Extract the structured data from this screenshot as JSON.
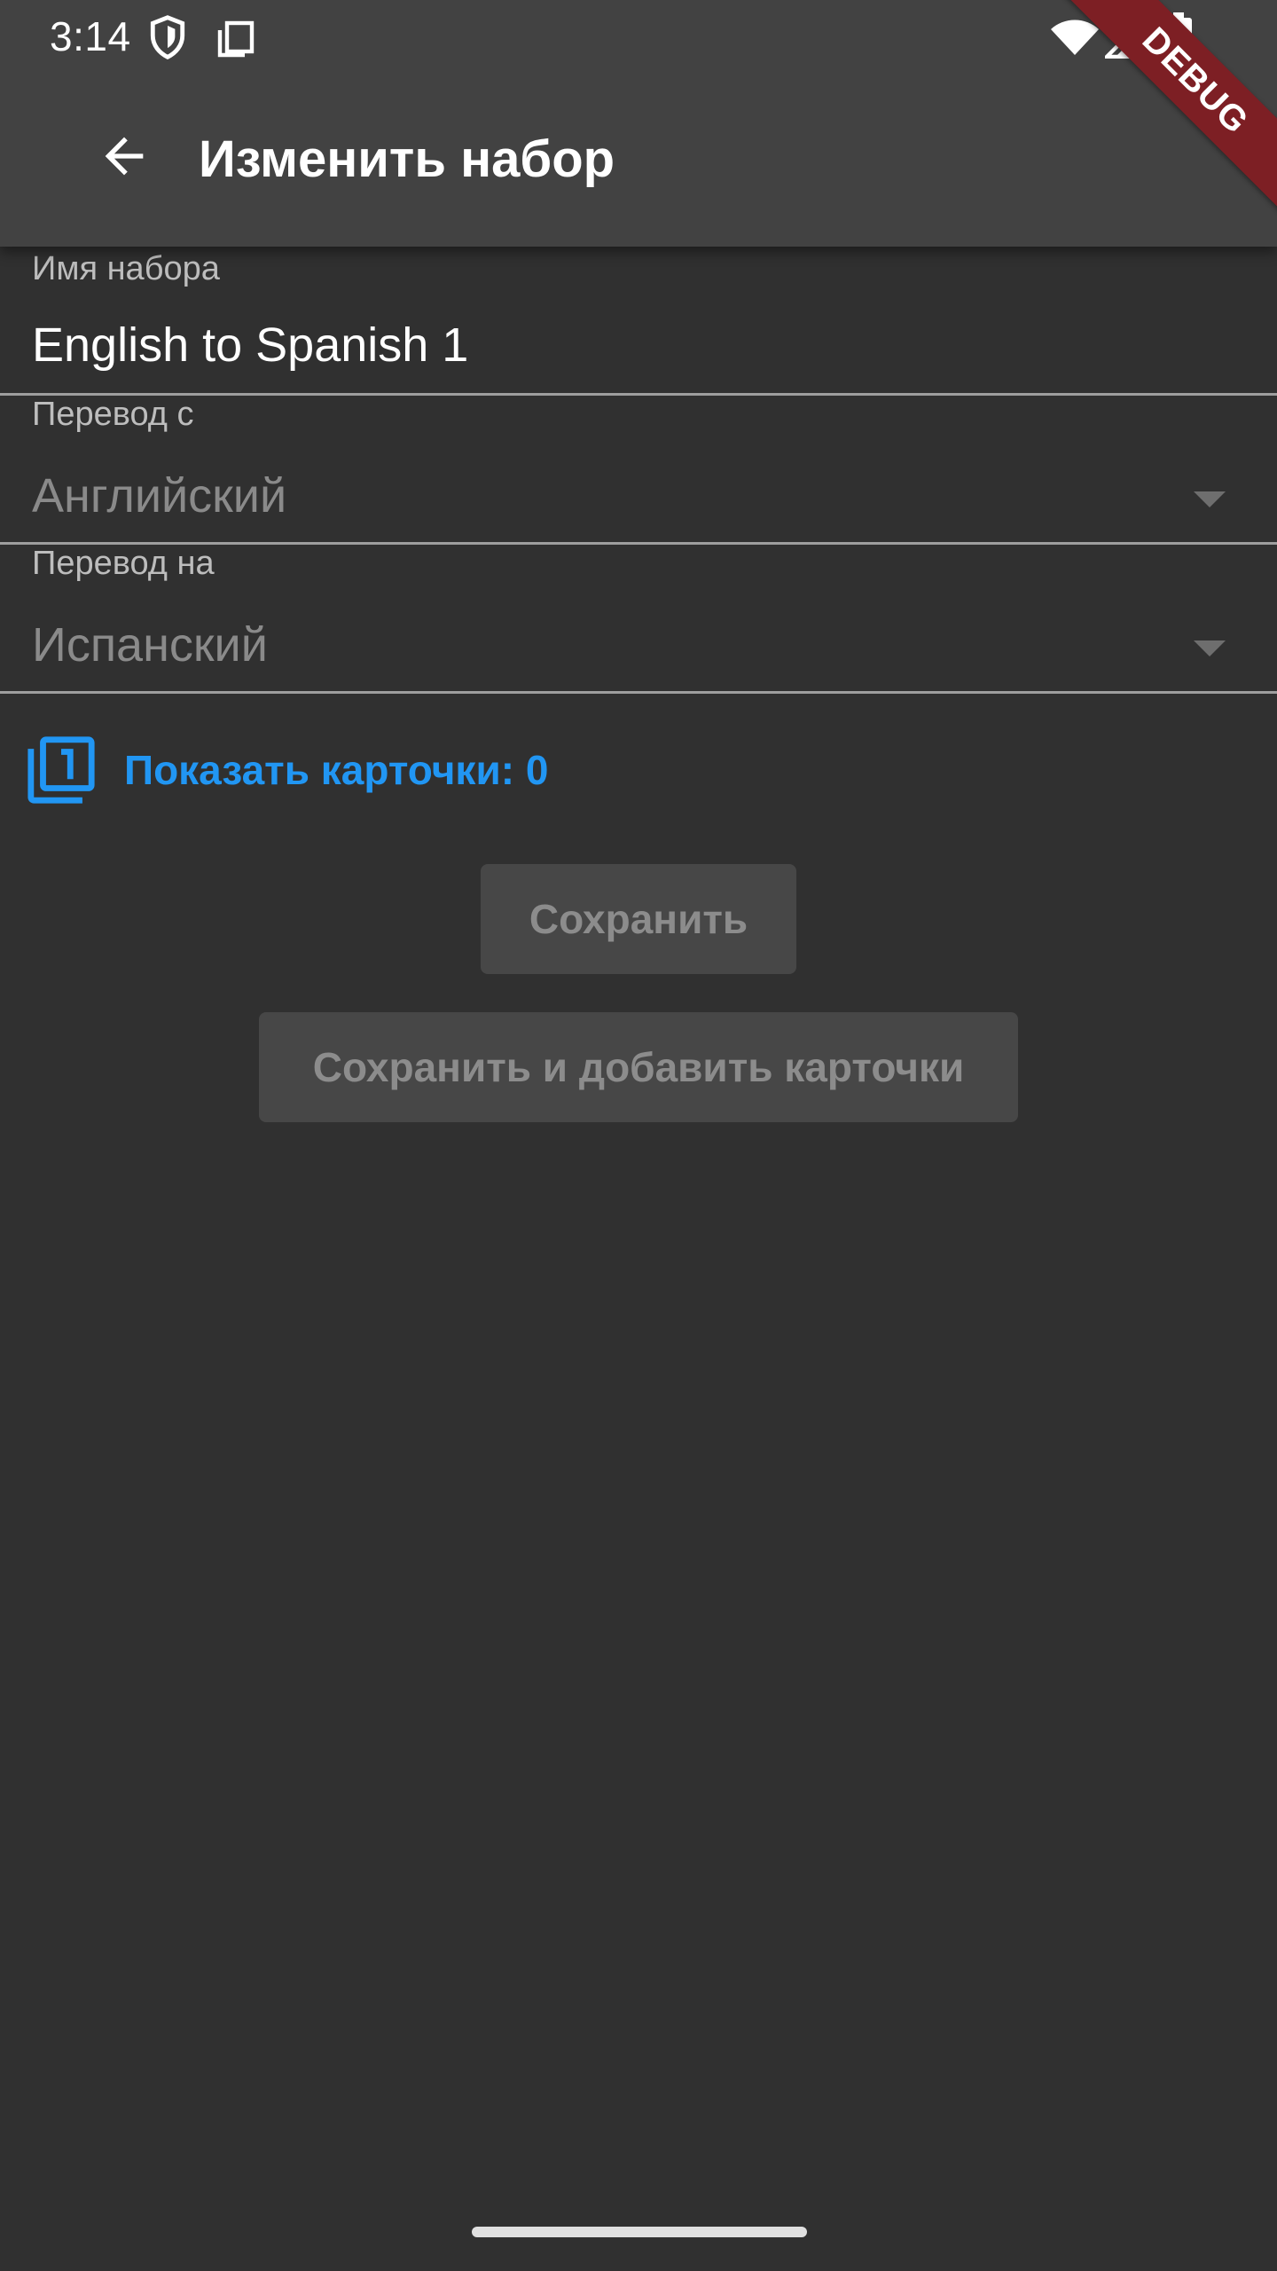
{
  "status_bar": {
    "time": "3:14",
    "icons": [
      "shield-icon",
      "copy-icon",
      "wifi-icon",
      "signal-icon",
      "battery-icon"
    ]
  },
  "app_bar": {
    "back_icon": "arrow-back-icon",
    "title": "Изменить набор"
  },
  "debug_banner": "DEBUG",
  "form": {
    "set_name": {
      "label": "Имя набора",
      "value": "English to Spanish 1"
    },
    "translate_from": {
      "label": "Перевод с",
      "value": "Английский"
    },
    "translate_to": {
      "label": "Перевод на",
      "value": "Испанский"
    }
  },
  "show_cards": {
    "icon": "filter-1-icon",
    "label": "Показать карточки: 0"
  },
  "buttons": {
    "save": "Сохранить",
    "save_and_add": "Сохранить и добавить карточки"
  },
  "colors": {
    "background": "#303030",
    "app_bar": "#424242",
    "accent": "#2196f3",
    "debug_ribbon": "#7d1f24",
    "disabled_button": "#474747"
  }
}
